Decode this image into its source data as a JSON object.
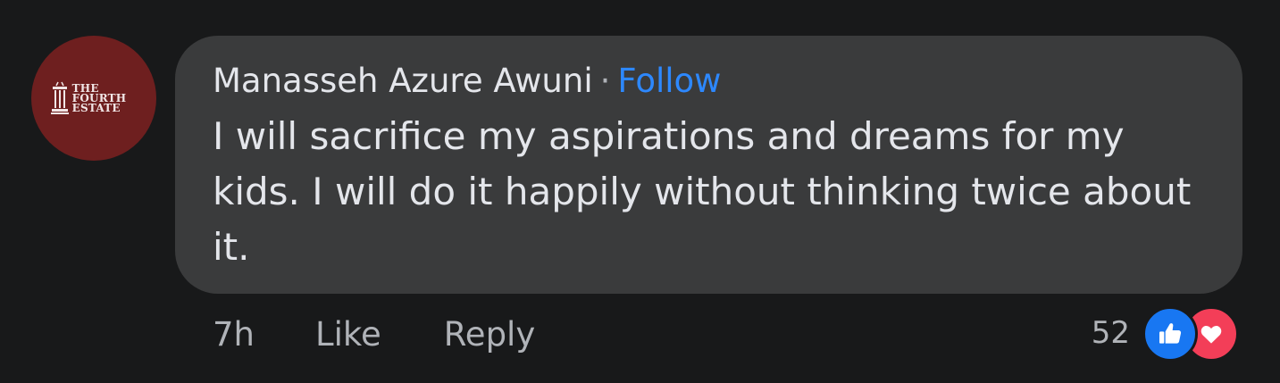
{
  "avatar": {
    "logo_lines": [
      "THE",
      "FOURTH",
      "ESTATE"
    ],
    "color": "#6e1f1f"
  },
  "comment": {
    "author": "Manasseh Azure Awuni",
    "separator": "·",
    "follow_label": "Follow",
    "text": "I will sacrifice my aspirations and dreams for my kids. I will do it happily without thinking twice about it."
  },
  "footer": {
    "time": "7h",
    "like_label": "Like",
    "reply_label": "Reply"
  },
  "reactions": {
    "count": "52",
    "types": [
      "like-icon",
      "love-icon"
    ],
    "like_color": "#1877f2",
    "love_color": "#f33e58"
  },
  "colors": {
    "background": "#18191a",
    "bubble": "#3a3b3c",
    "link": "#2d88ff",
    "secondary_text": "#b0b3b8"
  }
}
